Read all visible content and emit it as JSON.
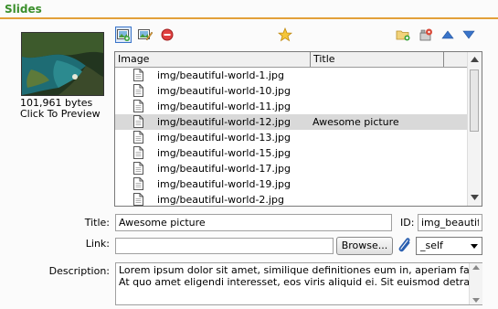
{
  "header": {
    "title": "Slides"
  },
  "preview": {
    "size": "101,961 bytes",
    "link": "Click To Preview"
  },
  "toolbar": {
    "icons": [
      "add-image-icon",
      "edit-image-icon",
      "remove-icon",
      "star-icon",
      "new-folder-icon",
      "settings-icon",
      "up-arrow-icon",
      "down-arrow-icon"
    ],
    "accent": "#3a74c9"
  },
  "list": {
    "columns": [
      "Image",
      "Title"
    ],
    "rows": [
      {
        "path": "img/beautiful-world-1.jpg",
        "title": ""
      },
      {
        "path": "img/beautiful-world-10.jpg",
        "title": ""
      },
      {
        "path": "img/beautiful-world-11.jpg",
        "title": ""
      },
      {
        "path": "img/beautiful-world-12.jpg",
        "title": "Awesome picture",
        "selected": true
      },
      {
        "path": "img/beautiful-world-13.jpg",
        "title": ""
      },
      {
        "path": "img/beautiful-world-15.jpg",
        "title": ""
      },
      {
        "path": "img/beautiful-world-17.jpg",
        "title": ""
      },
      {
        "path": "img/beautiful-world-19.jpg",
        "title": ""
      },
      {
        "path": "img/beautiful-world-2.jpg",
        "title": ""
      }
    ]
  },
  "form": {
    "title_label": "Title:",
    "title_value": "Awesome picture",
    "id_label": "ID:",
    "id_value": "img_beautiful",
    "link_label": "Link:",
    "link_value": "",
    "browse_label": "Browse...",
    "target_value": "_self",
    "description_label": "Description:",
    "description_value": "Lorem ipsum dolor sit amet, similique definitiones eum in, aperiam fabulas inveni\nAt quo amet eligendi interesset, eos viris aliquid ei. Sit euismod detracto ne."
  },
  "colors": {
    "header_text": "#3a8f2b",
    "header_line": "#e2a03a",
    "selected_row": "#d9d9d9"
  }
}
